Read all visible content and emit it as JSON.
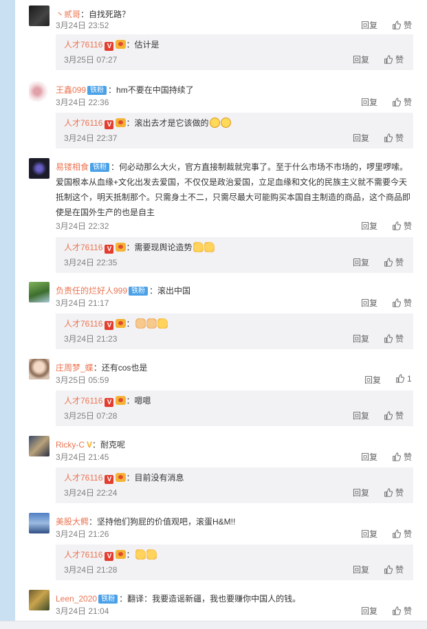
{
  "labels": {
    "reply": "回复",
    "like": "赞"
  },
  "colors": {
    "username": "#eb7350",
    "reply_bg": "#f2f2f5",
    "sidebar": "#c9dff2"
  },
  "comments": [
    {
      "user": "丶贰哥",
      "badge": "",
      "vmark": "",
      "text": "：自找死路？",
      "time": "3月24日 23:52",
      "likes": "",
      "reply": {
        "user": "人才76116",
        "text": "：估计是",
        "time": "3月25日 07:27",
        "likes": ""
      }
    },
    {
      "user": "王鑫099",
      "badge": "铁粉",
      "vmark": "",
      "text": "：hm不要在中国持续了",
      "time": "3月24日 22:36",
      "likes": "",
      "reply": {
        "user": "人才76116",
        "text": "：滚出去才是它该做的",
        "time": "3月24日 22:37",
        "likes": ""
      }
    },
    {
      "user": "易镂相食",
      "badge": "铁粉",
      "vmark": "",
      "text": "：何必动那么大火，官方直接制裁就完事了。至于什么市场不市场的，啰里啰嗦。",
      "text_lines": [
        "爱国根本从血缘+文化出发去爱国，不仅仅是政治爱国，立足血缘和文化的民族主义就不需要今天",
        "抵制这个，明天抵制那个。只需身土不二，只需尽最大可能购买本国自主制造的商品，这个商品即",
        "使是在国外生产的也是自主"
      ],
      "time": "3月24日 22:32",
      "likes": "",
      "reply": {
        "user": "人才76116",
        "text": "：需要现舆论造势",
        "time": "3月24日 22:35",
        "likes": ""
      }
    },
    {
      "user": "负责任的烂好人999",
      "badge": "铁粉",
      "vmark": "",
      "text": "：滚出中国",
      "time": "3月24日 21:17",
      "likes": "",
      "reply": {
        "user": "人才76116",
        "text": "：",
        "time": "3月24日 21:23",
        "likes": ""
      }
    },
    {
      "user": "庄周梦_蝶",
      "badge": "",
      "vmark": "",
      "text": "：还有cos也是",
      "time": "3月25日 05:59",
      "likes": "1",
      "reply": {
        "user": "人才76116",
        "text": "：嗯嗯",
        "time": "3月25日 07:28",
        "likes": ""
      }
    },
    {
      "user": "Ricky-C",
      "badge": "",
      "vmark": "V",
      "text": "：耐克呢",
      "time": "3月24日 21:45",
      "likes": "",
      "reply": {
        "user": "人才76116",
        "text": "：目前没有消息",
        "time": "3月24日 22:24",
        "likes": ""
      }
    },
    {
      "user": "美股大鳄",
      "badge": "",
      "vmark": "",
      "text": "：坚持他们狗屁的价值观吧，滚蛋H&M!!",
      "time": "3月24日 21:26",
      "likes": "",
      "reply": {
        "user": "人才76116",
        "text": "：",
        "time": "3月24日 21:28",
        "likes": ""
      }
    },
    {
      "user": "Leen_2020",
      "badge": "铁粉",
      "vmark": "",
      "text": "：翻译：我要造谣新疆，我也要赚你中国人的钱。",
      "time": "3月24日 21:04",
      "likes": ""
    }
  ]
}
